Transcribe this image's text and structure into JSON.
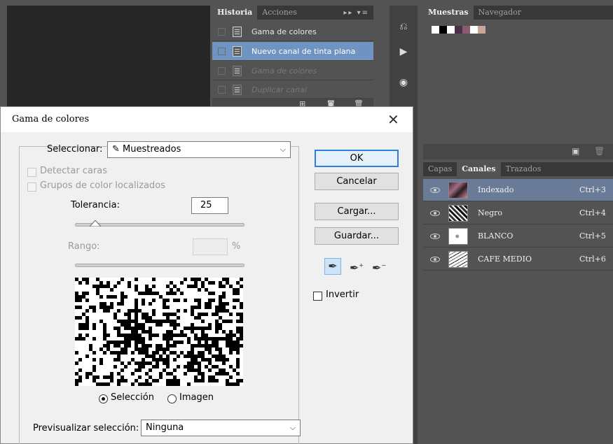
{
  "history_panel": {
    "tabs": [
      "Historia",
      "Acciones"
    ],
    "items": [
      {
        "label": "Gama de colores",
        "state": "normal"
      },
      {
        "label": "Nuevo canal de tinta plana",
        "state": "selected"
      },
      {
        "label": "Gama de colores",
        "state": "dimmed"
      },
      {
        "label": "Duplicar canal",
        "state": "dimmed"
      }
    ],
    "footer_icons": [
      "new-snapshot-icon",
      "camera-icon",
      "trash-icon"
    ]
  },
  "tool_strip": {
    "icons": [
      "history-brush-icon",
      "play-icon",
      "adjustments-icon",
      "info-icon"
    ]
  },
  "swatches_panel": {
    "tabs": [
      "Muestras",
      "Navegador"
    ],
    "swatch_colors": [
      "#ffffff",
      "#000000",
      "#ffffff",
      "#4a2f4a",
      "#8c5a6e",
      "#ffffff",
      "#c9a59a"
    ]
  },
  "channels_panel": {
    "tabs": [
      "Capas",
      "Canales",
      "Trazados"
    ],
    "channels": [
      {
        "name": "Indexado",
        "shortcut": "Ctrl+3",
        "selected": true
      },
      {
        "name": "Negro",
        "shortcut": "Ctrl+4",
        "selected": false
      },
      {
        "name": "BLANCO",
        "shortcut": "Ctrl+5",
        "selected": false
      },
      {
        "name": "CAFE MEDIO",
        "shortcut": "Ctrl+6",
        "selected": false
      }
    ]
  },
  "dialog": {
    "title": "Gama de colores",
    "close_glyph": "✕",
    "select_label": "Seleccionar:",
    "select_value": "Muestreados",
    "detect_faces_label": "Detectar caras",
    "localized_groups_label": "Grupos de color localizados",
    "tolerance_label": "Tolerancia:",
    "tolerance_value": "25",
    "tolerance_fraction": 0.12,
    "range_label": "Rango:",
    "range_unit": "%",
    "radio_selection_label": "Selección",
    "radio_image_label": "Imagen",
    "radio_selected": "Selección",
    "preview_label": "Previsualizar selección:",
    "preview_value": "Ninguna",
    "buttons": {
      "ok": "OK",
      "cancel": "Cancelar",
      "load": "Cargar...",
      "save": "Guardar..."
    },
    "invert_label": "Invertir",
    "eyedroppers": [
      "eyedropper-icon",
      "eyedropper-add-icon",
      "eyedropper-subtract-icon"
    ]
  }
}
